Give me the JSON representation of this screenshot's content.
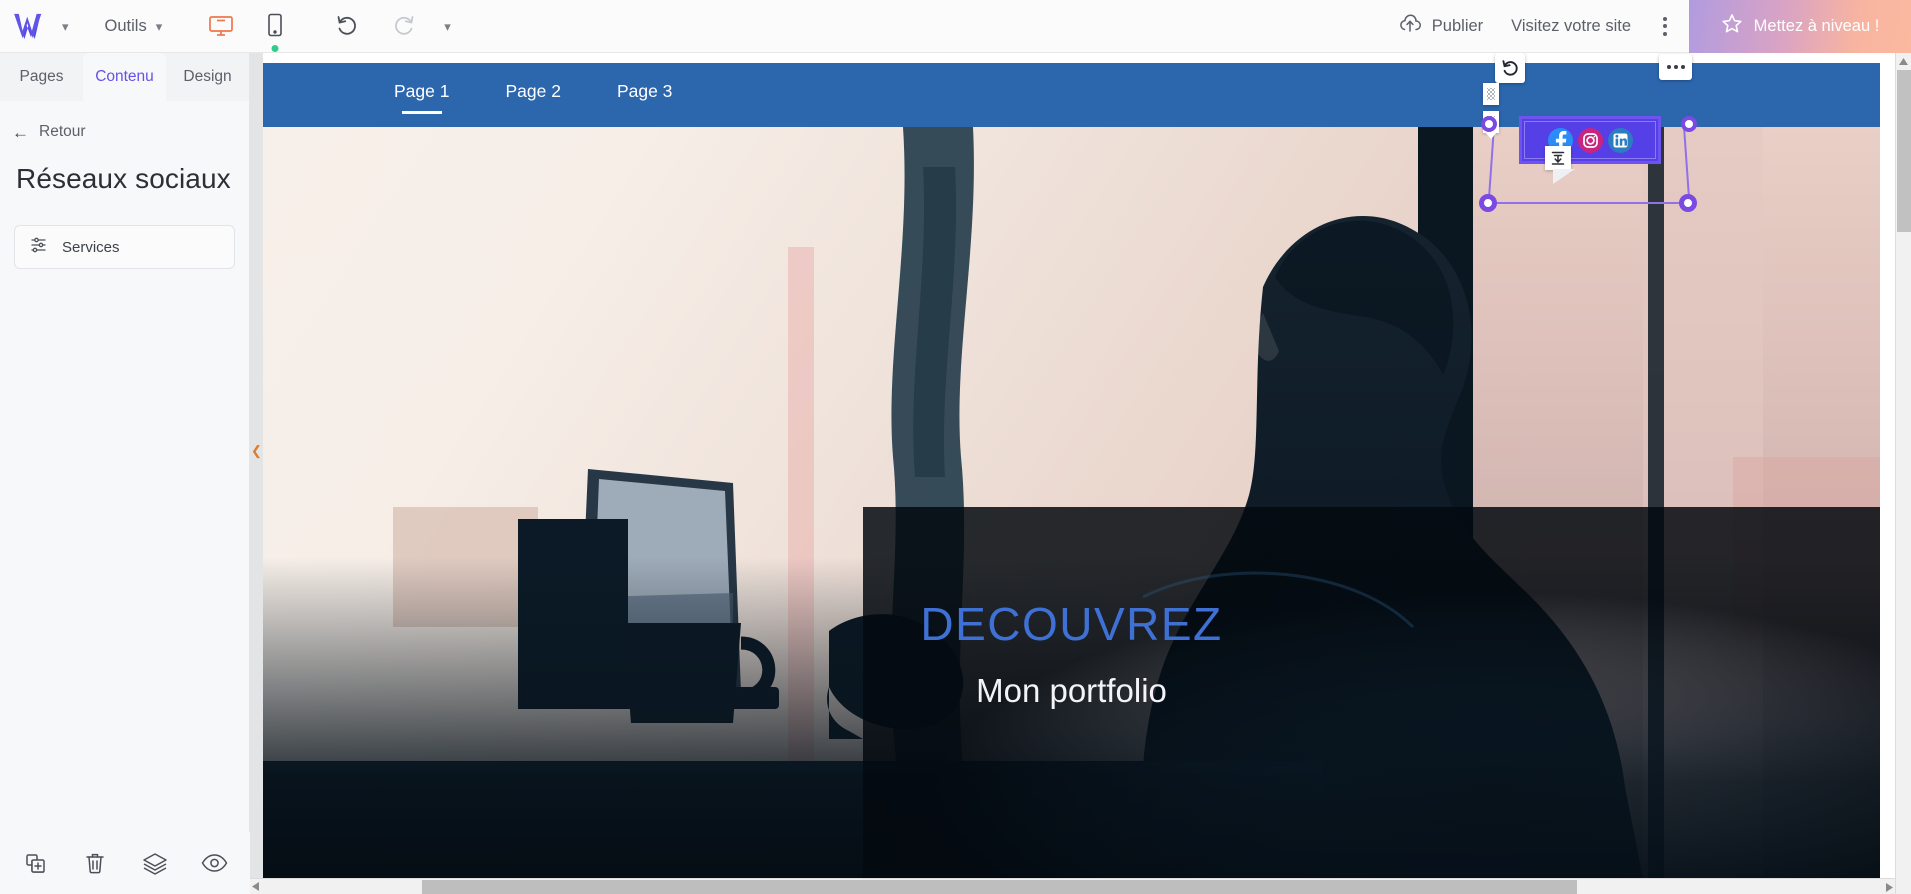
{
  "topbar": {
    "logo_icon": "webself-w-logo",
    "logo_caret_icon": "chevron-down-icon",
    "tools_label": "Outils",
    "tools_caret_icon": "chevron-down-icon",
    "desktop_icon": "desktop-monitor-icon",
    "mobile_icon": "mobile-phone-icon",
    "active_device": "desktop",
    "undo_icon": "undo-arrow-icon",
    "redo_icon": "redo-arrow-icon",
    "publish_icon": "cloud-upload-icon",
    "publish_label": "Publier",
    "visit_label": "Visitez votre site",
    "kebab_icon": "more-vertical-icon",
    "upgrade_icon": "star-icon",
    "upgrade_label": "Mettez à niveau !",
    "upgrade_gradient_start": "#b09be0",
    "upgrade_gradient_end": "#fbb9a0"
  },
  "panel": {
    "tabs": [
      {
        "label": "Pages",
        "active": false
      },
      {
        "label": "Contenu",
        "active": true
      },
      {
        "label": "Design",
        "active": false
      }
    ],
    "active_tab_color": "#6750e8",
    "back_icon": "arrow-left-icon",
    "back_label": "Retour",
    "title": "Réseaux sociaux",
    "items": [
      {
        "label": "Services",
        "icon": "sliders-settings-icon"
      }
    ],
    "bottom_tools": [
      {
        "name": "duplicate",
        "icon": "duplicate-icon"
      },
      {
        "name": "delete",
        "icon": "trash-icon"
      },
      {
        "name": "layers",
        "icon": "layers-icon"
      },
      {
        "name": "preview",
        "icon": "eye-icon"
      }
    ]
  },
  "canvas": {
    "collapse_icon": "chevron-left-icon",
    "collapse_color": "#e07b2a",
    "nav_background": "#2c66ad",
    "nav_links": [
      {
        "label": "Page 1",
        "active": true
      },
      {
        "label": "Page 2",
        "active": false
      },
      {
        "label": "Page 3",
        "active": false
      }
    ],
    "hero": {
      "title": "DECOUVREZ",
      "title_color": "#3f70d4",
      "subtitle": "Mon portfolio",
      "subtitle_color": "#f2f4f7",
      "image_alt": "silhouette-person-laptop-window"
    }
  },
  "selection": {
    "widget_type": "social-icons-widget",
    "border_color": "#7b4ae2",
    "fill_color": "#5540e8",
    "rotate_icon": "rotate-icon",
    "more_icon": "more-horizontal-icon",
    "drag_grip_icon": "drag-grip-icon",
    "align_icon": "align-bottom-icon",
    "social_icons": [
      {
        "name": "facebook",
        "glyph": "f",
        "color": "#2b8cf5"
      },
      {
        "name": "instagram",
        "glyph": "camera",
        "color": "#c9247f"
      },
      {
        "name": "linkedin",
        "glyph": "in",
        "color": "#2b7cc0"
      }
    ]
  },
  "scrollbars": {
    "vertical_up_icon": "triangle-up-icon",
    "horizontal_left_icon": "triangle-left-icon",
    "horizontal_right_icon": "triangle-right-icon"
  }
}
